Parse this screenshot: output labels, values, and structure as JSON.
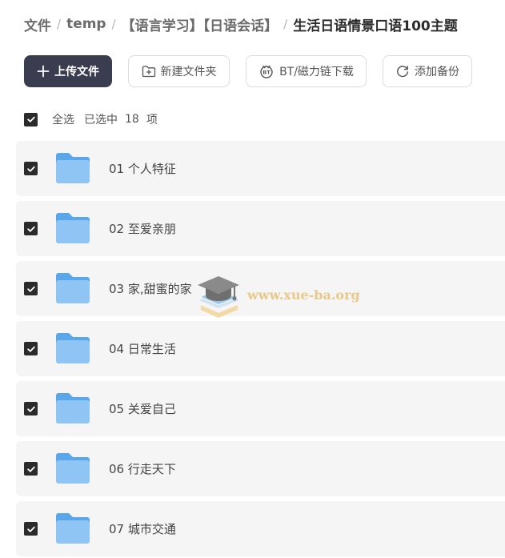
{
  "breadcrumb": [
    {
      "label": "文件"
    },
    {
      "label": "temp"
    },
    {
      "label": "【语言学习】【日语会话】"
    },
    {
      "label": "生活日语情景口语100主题"
    }
  ],
  "breadcrumb_separator": "/",
  "toolbar": {
    "upload_label": "上传文件",
    "new_folder_label": "新建文件夹",
    "bt_label": "BT/磁力链下载",
    "backup_label": "添加备份"
  },
  "selection": {
    "select_all_label": "全选",
    "selected_label": "已选中",
    "selected_count": "18",
    "selected_unit": "项"
  },
  "files": [
    {
      "name": "01 个人特征",
      "checked": true
    },
    {
      "name": "02 至爱亲朋",
      "checked": true
    },
    {
      "name": "03 家,甜蜜的家",
      "checked": true
    },
    {
      "name": "04 日常生活",
      "checked": true
    },
    {
      "name": "05 关爱自己",
      "checked": true
    },
    {
      "name": "06 行走天下",
      "checked": true
    },
    {
      "name": "07 城市交通",
      "checked": true
    }
  ],
  "watermark": {
    "text": "www.xue-ba.org"
  },
  "colors": {
    "primary_button": "#3a3d4f",
    "checkbox": "#2b2b2b",
    "row_background": "#f5f5f5",
    "folder_blue": "#8ec5f5",
    "watermark": "#e8c98a"
  }
}
